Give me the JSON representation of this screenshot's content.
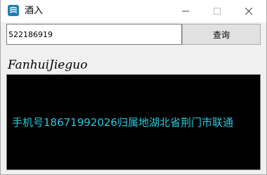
{
  "window": {
    "title": "酒入",
    "icon": "app-icon",
    "controls": [
      "minimize-icon",
      "maximize-icon",
      "close-icon"
    ]
  },
  "query": {
    "input_value": "522186919",
    "button_label": "查询"
  },
  "result": {
    "label": "FanhuiJieguo",
    "text": "手机号18671992026归属地湖北省荆门市联通",
    "text_color": "#28c8dc",
    "background": "#000000"
  }
}
